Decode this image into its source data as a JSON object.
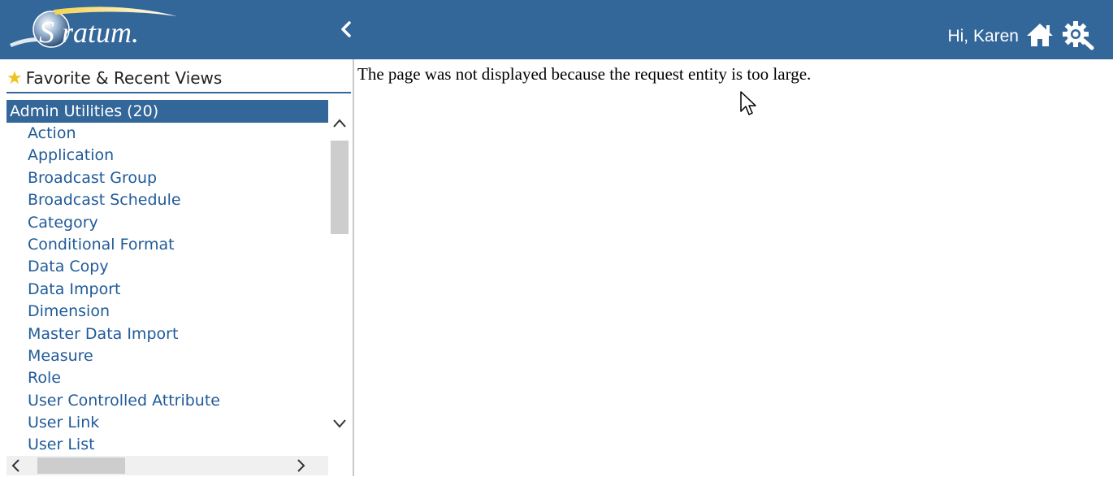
{
  "header": {
    "logo_text": "Stratum.",
    "greeting": "Hi, Karen",
    "collapse_icon": "chevron-left-icon",
    "home_icon": "home-icon",
    "settings_icon": "gear-icon",
    "bar_color": "#336699"
  },
  "sidebar": {
    "favorites_label": "Favorite & Recent Views",
    "favorites_icon": "star-icon",
    "group": {
      "label": "Admin Utilities (20)",
      "items": [
        "Action",
        "Application",
        "Broadcast Group",
        "Broadcast Schedule",
        "Category",
        "Conditional Format",
        "Data Copy",
        "Data Import",
        "Dimension",
        "Master Data Import",
        "Measure",
        "Role",
        "User Controlled Attribute",
        "User Link",
        "User List"
      ]
    }
  },
  "main": {
    "message": "The page was not displayed because the request entity is too large."
  }
}
